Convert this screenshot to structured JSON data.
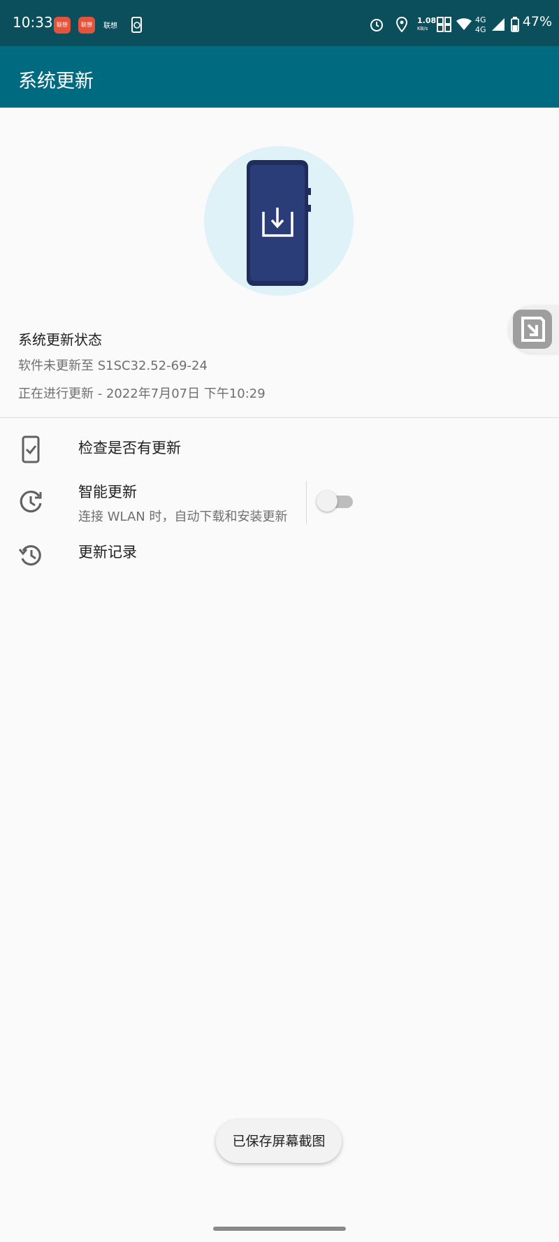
{
  "status_bar": {
    "time": "10:33",
    "app_icons": [
      "联想",
      "联想",
      "联想"
    ],
    "net_speed": "1.08",
    "net_speed_unit": "KB/s",
    "signal_label": "4G",
    "signal_label2": "4G",
    "battery": "47%"
  },
  "app_bar": {
    "title": "系统更新"
  },
  "status": {
    "title": "系统更新状态",
    "version_line": "软件未更新至 S1SC32.52-69-24",
    "progress_line": "正在进行更新 - 2022年7月07日 下午10:29"
  },
  "menu": {
    "check_label": "检查是否有更新",
    "smart_label": "智能更新",
    "smart_sub": "连接 WLAN 时，自动下载和安装更新",
    "history_label": "更新记录",
    "smart_enabled": false
  },
  "toast": {
    "text": "已保存屏幕截图"
  },
  "colors": {
    "status_bar": "#0b4f5d",
    "app_bar": "#006a80",
    "hero_bg": "#def2f8",
    "phone": "#1f2d5c"
  }
}
